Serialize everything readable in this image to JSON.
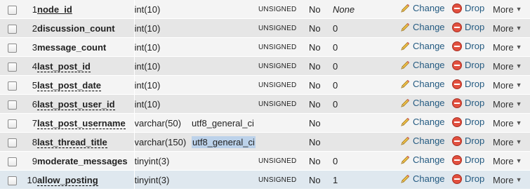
{
  "actions": {
    "change": "Change",
    "drop": "Drop",
    "more": "More"
  },
  "columns": [
    {
      "num": "1",
      "name": "node_id",
      "type": "int(10)",
      "collation": "",
      "attributes": "UNSIGNED",
      "null": "No",
      "default": "None"
    },
    {
      "num": "2",
      "name": "discussion_count",
      "type": "int(10)",
      "collation": "",
      "attributes": "UNSIGNED",
      "null": "No",
      "default": "0"
    },
    {
      "num": "3",
      "name": "message_count",
      "type": "int(10)",
      "collation": "",
      "attributes": "UNSIGNED",
      "null": "No",
      "default": "0"
    },
    {
      "num": "4",
      "name": "last_post_id",
      "type": "int(10)",
      "collation": "",
      "attributes": "UNSIGNED",
      "null": "No",
      "default": "0"
    },
    {
      "num": "5",
      "name": "last_post_date",
      "type": "int(10)",
      "collation": "",
      "attributes": "UNSIGNED",
      "null": "No",
      "default": "0"
    },
    {
      "num": "6",
      "name": "last_post_user_id",
      "type": "int(10)",
      "collation": "",
      "attributes": "UNSIGNED",
      "null": "No",
      "default": "0"
    },
    {
      "num": "7",
      "name": "last_post_username",
      "type": "varchar(50)",
      "collation": "utf8_general_ci",
      "attributes": "",
      "null": "No",
      "default": ""
    },
    {
      "num": "8",
      "name": "last_thread_title",
      "type": "varchar(150)",
      "collation": "utf8_general_ci",
      "attributes": "",
      "null": "No",
      "default": ""
    },
    {
      "num": "9",
      "name": "moderate_messages",
      "type": "tinyint(3)",
      "collation": "",
      "attributes": "UNSIGNED",
      "null": "No",
      "default": "0"
    },
    {
      "num": "10",
      "name": "allow_posting",
      "type": "tinyint(3)",
      "collation": "",
      "attributes": "UNSIGNED",
      "null": "No",
      "default": "1"
    }
  ]
}
